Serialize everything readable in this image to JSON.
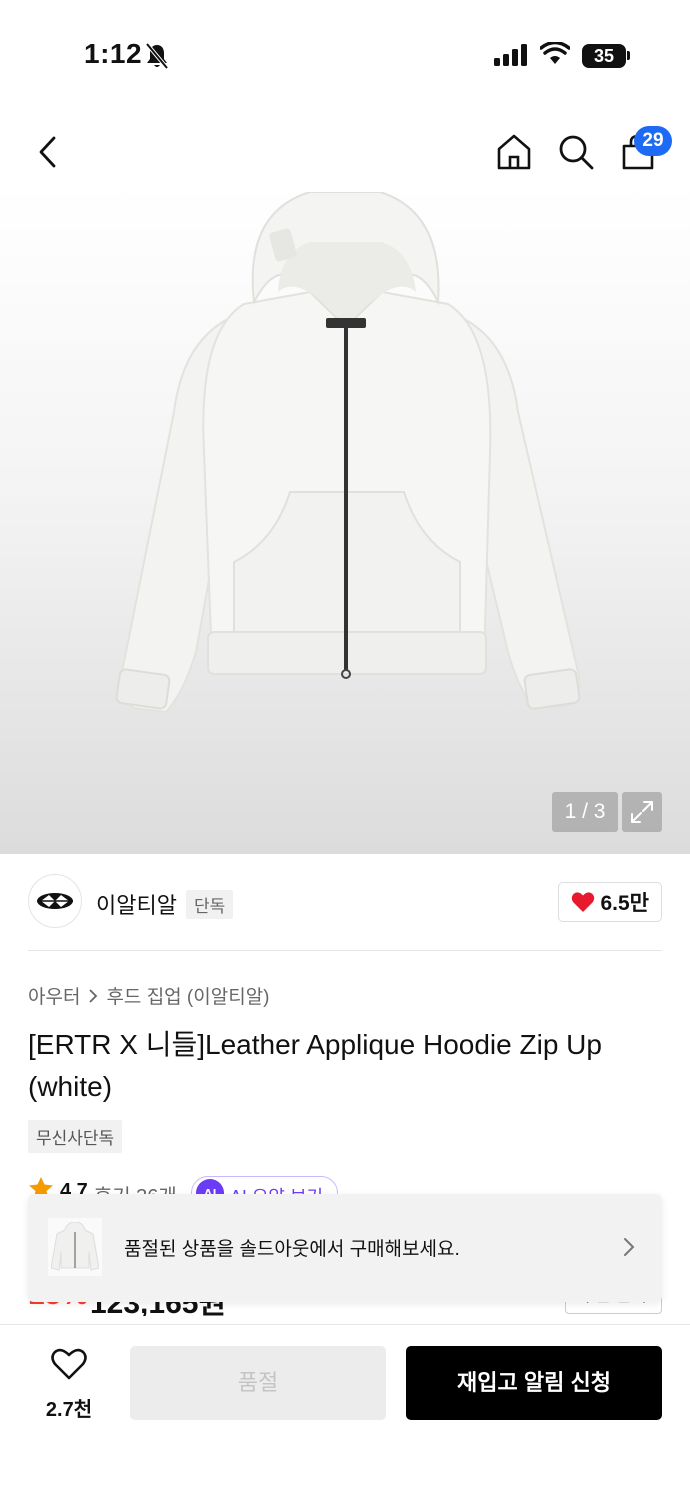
{
  "status_bar": {
    "time": "1:12",
    "battery": "35"
  },
  "nav": {
    "cart_count": "29"
  },
  "gallery": {
    "counter": "1 / 3"
  },
  "brand": {
    "name": "이알티알",
    "tag": "단독",
    "likes": "6.5만"
  },
  "breadcrumb": {
    "category": "아우터",
    "subcategory": "후드 집업 (이알티알)"
  },
  "product": {
    "title": "[ERTR X 니들]Leather Applique Hoodie Zip Up (white)",
    "store_tag": "무신사단독"
  },
  "rating": {
    "value": "4.7",
    "reviews": "후기 36개",
    "ai_badge": "AI",
    "ai_label": "AI 요약 보기"
  },
  "price": {
    "discount": "15%",
    "amount": "123,165원",
    "coupon": "쿠폰 받기"
  },
  "toast": {
    "message": "품절된 상품을 솔드아웃에서 구매해보세요."
  },
  "bottom": {
    "wish_count": "2.7천",
    "soldout": "품절",
    "restock": "재입고 알림 신청"
  },
  "colors": {
    "accent_blue": "#1e6af5",
    "heart_red": "#e8192c",
    "discount_red": "#ff3a2e",
    "ai_purple": "#6b3cf6"
  }
}
